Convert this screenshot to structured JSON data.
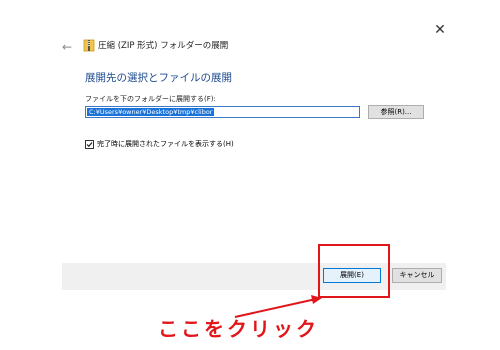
{
  "dialog": {
    "title": "圧縮 (ZIP 形式) フォルダーの展開",
    "close_glyph": "✕",
    "back_glyph": "←",
    "heading": "展開先の選択とファイルの展開",
    "path_label": "ファイルを下のフォルダーに展開する(F):",
    "path_value": "C:¥Users¥owner¥Desktop¥tmp¥clibor",
    "browse_label": "参照(R)...",
    "show_files_label": "完了時に展開されたファイルを表示する(H)",
    "show_files_checked": true,
    "extract_label": "展開(E)",
    "cancel_label": "キャンセル"
  },
  "annotation": {
    "text": "ここをクリック",
    "color": "#e0161b"
  },
  "colors": {
    "heading": "#1e4a8f",
    "selection": "#1a73d9",
    "footer": "#f0f0f0",
    "default_button_border": "#0078d7"
  },
  "icons": {
    "title_icon": "zip-folder-icon",
    "back": "back-arrow-icon",
    "close": "close-icon",
    "check": "checkmark-icon"
  }
}
